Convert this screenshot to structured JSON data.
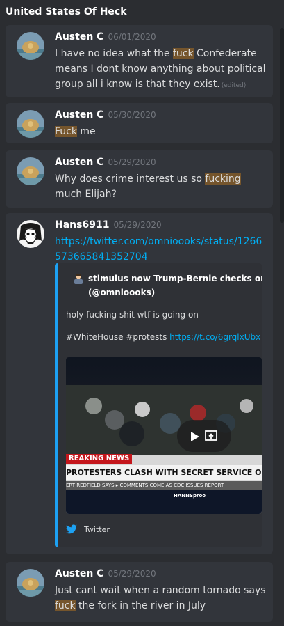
{
  "header": {
    "title": "United States Of Heck"
  },
  "messages": [
    {
      "author": "Austen C",
      "date": "06/01/2020",
      "before": "I have no idea what the ",
      "word": "fuck",
      "after": " Confederate means I dont know anything about political group all i know is that they exist.",
      "edited": "(edited)"
    },
    {
      "author": "Austen C",
      "date": "05/30/2020",
      "before": "",
      "word": "Fuck",
      "after": " me"
    },
    {
      "author": "Austen C",
      "date": "05/29/2020",
      "before": "Why does crime interest us so ",
      "word": "fucking",
      "after": " much Elijah?"
    },
    {
      "author": "Hans6911",
      "date": "05/29/2020",
      "link": "https://twitter.com/omnioooks/status/1266573665841352704"
    },
    {
      "author": "Austen C",
      "date": "05/29/2020",
      "before": "Just cant wait when a random tornado says ",
      "word": "fuck",
      "after": " the fork in the river in July"
    }
  ],
  "embed": {
    "author_line1": "stimulus now Trump-Bernie checks omn",
    "author_line2": "(@omnioooks)",
    "description": "holy fucking shit wtf is going on",
    "hashtags": "#WhiteHouse #protests ",
    "tco_link": "https://t.co/6grqlxUbx",
    "image_banner": "REAKING NEWS",
    "image_headline": "PROTESTERS CLASH WITH SECRET SERVICE OUTSIDE WHITE",
    "image_ticker": "ERT REDFIELD SAYS  ▸ COMMENTS COME AS CDC ISSUES REPORT",
    "image_show": "HANNSproo",
    "footer": "Twitter"
  },
  "colors": {
    "highlight": "#75552c",
    "link": "#00aff4",
    "twitter": "#1da1f2"
  }
}
